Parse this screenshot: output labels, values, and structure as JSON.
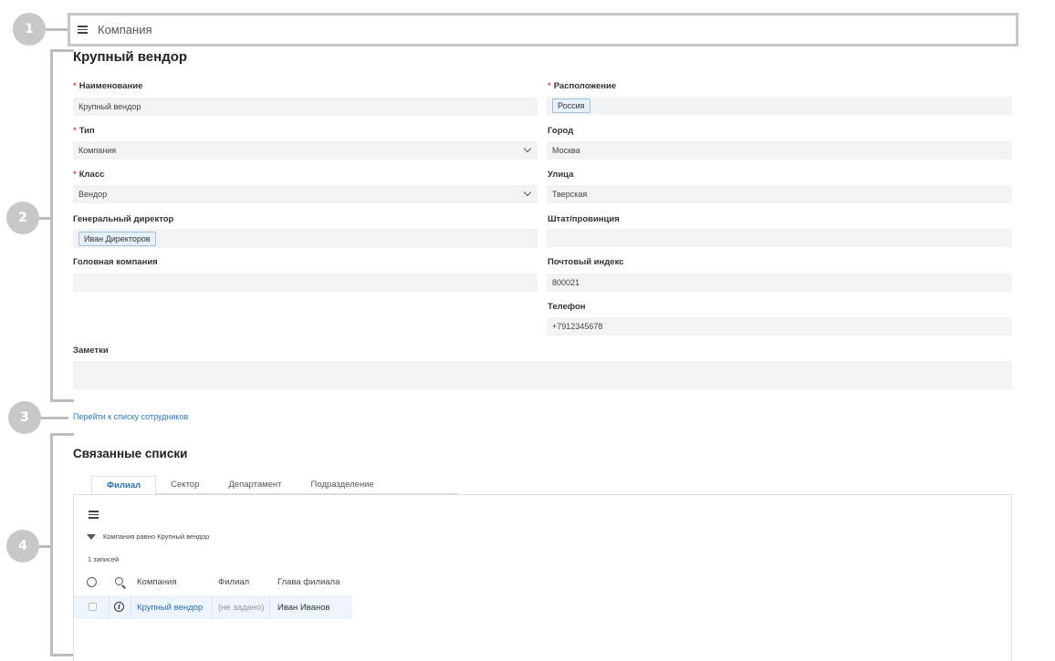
{
  "markers": [
    "1",
    "2",
    "3",
    "4"
  ],
  "header": {
    "title": "Компания"
  },
  "page_title": "Крупный вендор",
  "left_fields": {
    "name": {
      "label": "Наименование",
      "value": "Крупный вендор"
    },
    "type": {
      "label": "Тип",
      "value": "Компания"
    },
    "class": {
      "label": "Класс",
      "value": "Вендор"
    },
    "ceo": {
      "label": "Генеральный директор",
      "value": "Иван Директоров"
    },
    "parent": {
      "label": "Головная компания",
      "value": ""
    },
    "notes": {
      "label": "Заметки",
      "value": ""
    }
  },
  "right_fields": {
    "location": {
      "label": "Расположение",
      "value": "Россия"
    },
    "city": {
      "label": "Город",
      "value": "Москва"
    },
    "street": {
      "label": "Улица",
      "value": "Тверская"
    },
    "state": {
      "label": "Штат/провинция",
      "value": ""
    },
    "zip": {
      "label": "Почтовый индекс",
      "value": "800021"
    },
    "phone": {
      "label": "Телефон",
      "value": "+7912345678"
    }
  },
  "required_mark": "*",
  "employees_link": "Перейти к списку сотрудников",
  "related": {
    "title": "Связанные списки",
    "tabs": [
      "Филиал",
      "Сектор",
      "Департамент",
      "Подразделение"
    ],
    "filter_text": "Компания равно Крупный вендор",
    "records_count": "1 записей",
    "columns": [
      "Компания",
      "Филиал",
      "Глава филиала"
    ],
    "rows": [
      {
        "company": "Крупный вендор",
        "branch": "(не задано)",
        "head": "Иван Иванов"
      }
    ]
  },
  "icons": [
    "menu-icon",
    "chevron-down-icon",
    "filter-icon",
    "gear-icon",
    "search-icon",
    "info-icon"
  ],
  "colors": {
    "link": "#2a78c5",
    "required": "#d9534f",
    "chip_bg": "#e6f1fb",
    "row_highlight": "#eef4fb",
    "marker": "#c8c8c8"
  }
}
